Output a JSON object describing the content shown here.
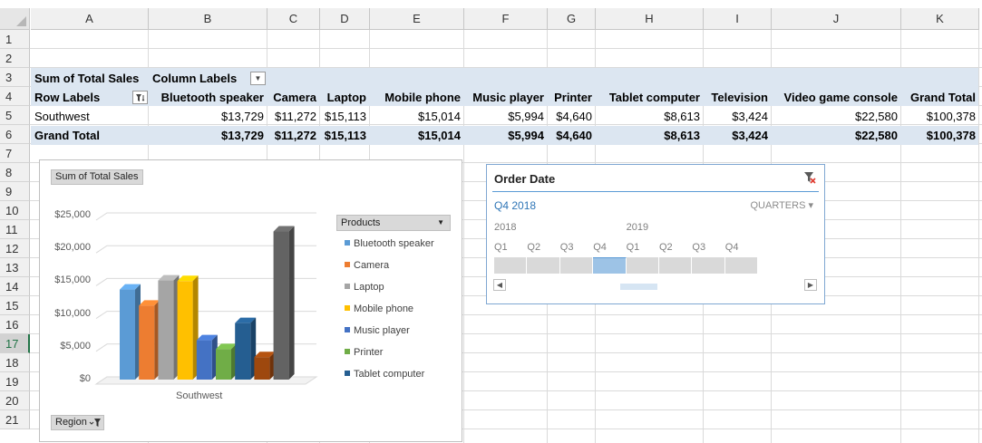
{
  "columns": [
    "A",
    "B",
    "C",
    "D",
    "E",
    "F",
    "G",
    "H",
    "I",
    "J",
    "K"
  ],
  "rows": [
    "1",
    "2",
    "3",
    "4",
    "5",
    "6",
    "7",
    "8",
    "9",
    "10",
    "11",
    "12",
    "13",
    "14",
    "15",
    "16",
    "17",
    "18",
    "19",
    "20",
    "21"
  ],
  "selected_row": "17",
  "pivot": {
    "value_header": "Sum of Total Sales",
    "column_labels": "Column Labels",
    "row_labels": "Row Labels",
    "headers": [
      "Bluetooth speaker",
      "Camera",
      "Laptop",
      "Mobile phone",
      "Music player",
      "Printer",
      "Tablet computer",
      "Television",
      "Video game console",
      "Grand Total"
    ],
    "data_row": {
      "label": "Southwest",
      "values": [
        "$13,729",
        "$11,272",
        "$15,113",
        "$15,014",
        "$5,994",
        "$4,640",
        "$8,613",
        "$3,424",
        "$22,580",
        "$100,378"
      ]
    },
    "total_row": {
      "label": "Grand Total",
      "values": [
        "$13,729",
        "$11,272",
        "$15,113",
        "$15,014",
        "$5,994",
        "$4,640",
        "$8,613",
        "$3,424",
        "$22,580",
        "$100,378"
      ]
    }
  },
  "chart": {
    "value_field_button": "Sum of Total Sales",
    "axis_field_button": "Region",
    "legend_field_button": "Products",
    "y_tick_labels": [
      "$25,000",
      "$20,000",
      "$15,000",
      "$10,000",
      "$5,000",
      "$0"
    ],
    "category_label": "Southwest"
  },
  "chart_data": {
    "type": "bar",
    "categories": [
      "Southwest"
    ],
    "series": [
      {
        "name": "Bluetooth speaker",
        "values": [
          13729
        ],
        "color": "#5b9bd5"
      },
      {
        "name": "Camera",
        "values": [
          11272
        ],
        "color": "#ed7d31"
      },
      {
        "name": "Laptop",
        "values": [
          15113
        ],
        "color": "#a5a5a5"
      },
      {
        "name": "Mobile phone",
        "values": [
          15014
        ],
        "color": "#ffc000"
      },
      {
        "name": "Music player",
        "values": [
          5994
        ],
        "color": "#4472c4"
      },
      {
        "name": "Printer",
        "values": [
          4640
        ],
        "color": "#70ad47"
      },
      {
        "name": "Tablet computer",
        "values": [
          8613
        ],
        "color": "#255e91"
      },
      {
        "name": "Television",
        "values": [
          3424
        ],
        "color": "#9e480e"
      },
      {
        "name": "Video game console",
        "values": [
          22580
        ],
        "color": "#636363"
      }
    ],
    "legend_visible": [
      "Bluetooth speaker",
      "Camera",
      "Laptop",
      "Mobile phone",
      "Music player",
      "Printer",
      "Tablet computer"
    ],
    "ylim": [
      0,
      25000
    ],
    "grid": true,
    "legend_position": "right",
    "three_d": true
  },
  "timeline": {
    "title": "Order Date",
    "selection": "Q4 2018",
    "level": "QUARTERS",
    "years": [
      "2018",
      "2019"
    ],
    "quarters": [
      "Q1",
      "Q2",
      "Q3",
      "Q4",
      "Q1",
      "Q2",
      "Q3",
      "Q4"
    ],
    "selected_index": 3
  },
  "icons": {
    "clear_filter": "clear-filter-icon",
    "dropdown": "chevron-down-icon",
    "filter": "filter-icon"
  }
}
